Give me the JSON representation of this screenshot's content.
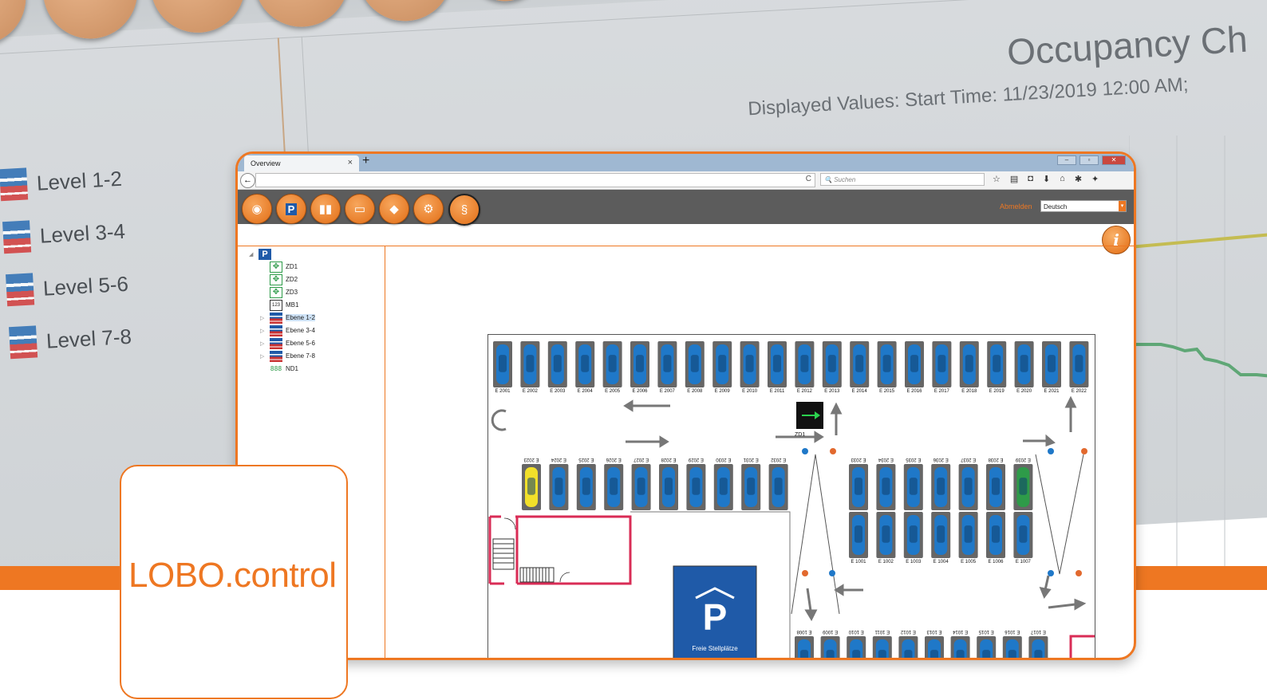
{
  "background": {
    "title": "Occupancy Ch",
    "subtitle": "Displayed Values: Start Time: 11/23/2019 12:00 AM;",
    "levels": [
      "Level 1-2",
      "Level 3-4",
      "Level 5-6",
      "Level 7-8"
    ]
  },
  "browser": {
    "tab_title": "Overview",
    "search_placeholder": "Suchen",
    "reload_icon": "C"
  },
  "appbar": {
    "buttons": [
      "dashboard-icon",
      "parking-icon",
      "statistics-icon",
      "document-icon",
      "color-icon",
      "settings-icon",
      "paragraph-icon"
    ],
    "logout": "Abmelden",
    "language": "Deutsch"
  },
  "tree": {
    "root": "P",
    "items": [
      {
        "label": "ZD1",
        "icon": "direction-icon"
      },
      {
        "label": "ZD2",
        "icon": "direction-icon"
      },
      {
        "label": "ZD3",
        "icon": "direction-icon"
      },
      {
        "label": "MB1",
        "icon": "counter-icon",
        "icon_text": "123"
      },
      {
        "label": "Ebene 1-2",
        "icon": "level-icon",
        "selected": true
      },
      {
        "label": "Ebene 3-4",
        "icon": "level-icon"
      },
      {
        "label": "Ebene 5-6",
        "icon": "level-icon"
      },
      {
        "label": "Ebene 7-8",
        "icon": "level-icon"
      },
      {
        "label": "ND1",
        "icon": "display-icon",
        "icon_text": "888"
      }
    ]
  },
  "plan": {
    "top_row": [
      "E 2001",
      "E 2002",
      "E 2003",
      "E 2004",
      "E 2005",
      "E 2006",
      "E 2007",
      "E 2008",
      "E 2009",
      "E 2010",
      "E 2011",
      "E 2012",
      "E 2013",
      "E 2014",
      "E 2015",
      "E 2016",
      "E 2017",
      "E 2018",
      "E 2019",
      "E 2020",
      "E 2021",
      "E 2022"
    ],
    "middle_left": [
      "E 2023",
      "E 2024",
      "E 2025",
      "E 2026",
      "E 2027",
      "E 2028",
      "E 2029",
      "E 2030",
      "E 2031",
      "E 2032"
    ],
    "middle_right": [
      "E 2033",
      "E 2034",
      "E 2035",
      "E 2036",
      "E 2037",
      "E 2038",
      "E 2039"
    ],
    "lower_right": [
      "E 1001",
      "E 1002",
      "E 1003",
      "E 1004",
      "E 1005",
      "E 1006",
      "E 1007"
    ],
    "bottom_row": [
      "E 1008",
      "E 1009",
      "E 1010",
      "E 1011",
      "E 1012",
      "E 1013",
      "E 1014",
      "E 1015",
      "E 1016",
      "E 1017"
    ],
    "direction_label": "ZD1",
    "sign_letter": "P",
    "sign_text": "Freie Stellplätze",
    "colors": {
      "free": "#1f78c8",
      "yellow": "#f2e02a",
      "green": "#2e9b49"
    }
  },
  "brand": {
    "name": "LOBO.control",
    "accent": "#ee7722"
  }
}
